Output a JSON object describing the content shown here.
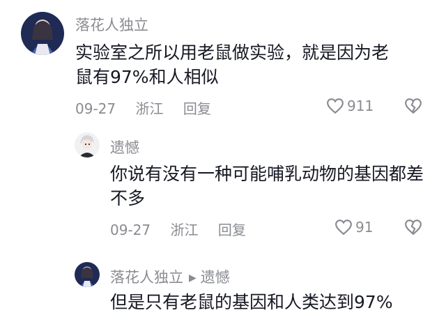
{
  "comments": [
    {
      "username": "落花人独立",
      "text": "实验室之所以用老鼠做实验，就是因为老鼠有97%和人相似",
      "date": "09-27",
      "location": "浙江",
      "reply_label": "回复",
      "likes": "911"
    },
    {
      "username": "遗憾",
      "text": "你说有没有一种可能哺乳动物的基因都差不多",
      "date": "09-27",
      "location": "浙江",
      "reply_label": "回复",
      "likes": "91"
    },
    {
      "username": "落花人独立",
      "reply_to": "遗憾",
      "text": "但是只有老鼠的基因和人类达到97%"
    }
  ],
  "icons": {
    "like": "heart-outline-icon",
    "dislike": "broken-heart-icon",
    "reply_arrow": "triangle-right-icon"
  }
}
